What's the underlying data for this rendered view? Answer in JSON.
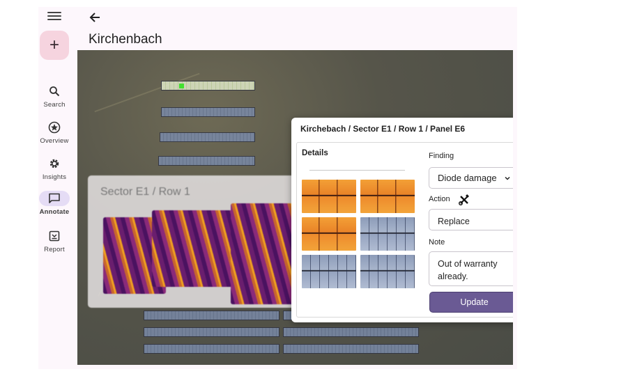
{
  "rail": {
    "items": [
      {
        "label": "Search",
        "icon": "search-icon"
      },
      {
        "label": "Overview",
        "icon": "star-circle-icon"
      },
      {
        "label": "Insights",
        "icon": "gear-icon"
      },
      {
        "label": "Annotate",
        "icon": "comment-icon",
        "active": true
      },
      {
        "label": "Report",
        "icon": "report-icon"
      }
    ]
  },
  "header": {
    "title": "Kirchenbach"
  },
  "map": {
    "sector_title": "Sector E1 / Row 1"
  },
  "popup": {
    "breadcrumb": "Kirchebach / Sector E1 / Row 1 / Panel E6",
    "details_label": "Details",
    "finding_label": "Finding",
    "finding_value": "Diode damage",
    "action_label": "Action",
    "action_value": "Replace",
    "note_label": "Note",
    "note_value": "Out of warranty already.",
    "update_label": "Update"
  },
  "colors": {
    "accent": "#6a5a94",
    "fab": "#f6d4df",
    "rail_active": "#e5dcf5",
    "highlight_panel": "#43e030"
  }
}
